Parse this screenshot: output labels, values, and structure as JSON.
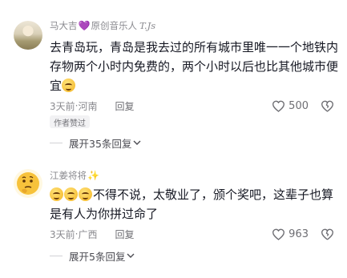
{
  "comments": [
    {
      "username": "马大吉",
      "badge_icon": "purple-heart",
      "title_tag": "原创音乐人",
      "title_tag_suffix": "T.Js",
      "text": "去青岛玩，青岛是我去过的所有城市里唯一一个地铁内存物两个小时内免费的，两个小时以后也比其他城市便宜",
      "trailing_emoji": "blush-face",
      "time": "3天前",
      "location": "河南",
      "reply_label": "回复",
      "likes": "500",
      "author_badge": "作者赞过",
      "expand_label": "展开35条回复"
    },
    {
      "username": "江姜将将",
      "badge_icon": "sparkles",
      "leading_emojis": [
        "smile-face",
        "smile-face",
        "smile-face"
      ],
      "text": "不得不说，太敬业了，颁个奖吧，这辈子也算是有人为你拼过命了",
      "time": "3天前",
      "location": "广西",
      "reply_label": "回复",
      "likes": "963",
      "expand_label": "展开5条回复"
    }
  ],
  "colors": {
    "text": "#161823",
    "meta": "#8a8a8f",
    "heart": "#a855f7"
  }
}
